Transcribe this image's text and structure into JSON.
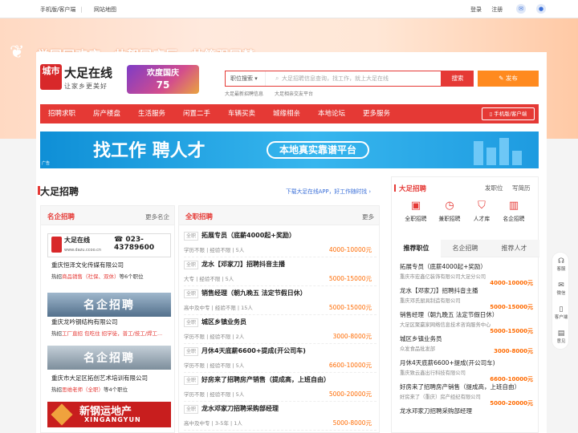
{
  "topbar": {
    "left": [
      "手机版/客户端",
      "网站地图"
    ],
    "login": "登录",
    "register": "注册"
  },
  "hero": {
    "slogan": "举国同欢庆，共贺国庆辰，共筑强国梦"
  },
  "logo": {
    "seal": "城市",
    "name": "大足在线",
    "tagline": "让家乡更美好"
  },
  "badge": {
    "line1": "欢度国庆",
    "line2": "75"
  },
  "search": {
    "category": "职位搜索",
    "placeholder": "大足招聘信息查询，找工作，就上大足在线",
    "button": "搜索",
    "post": "发布",
    "hints": [
      "大足最新招聘信息",
      "大足相亲交友平台"
    ]
  },
  "nav": {
    "items": [
      "招聘求职",
      "房产楼盘",
      "生活服务",
      "闲置二手",
      "车辆买卖",
      "城缘相亲",
      "本地论坛",
      "更多服务"
    ],
    "app": "手机版/客户端"
  },
  "banner": {
    "text": "找工作 聘人才",
    "slogan": "本地真实靠谱平台",
    "tag": "广告"
  },
  "section": {
    "title": "大足招聘",
    "note": "下载大足在线APP，好工作随时找"
  },
  "left": {
    "title": "名企招聘",
    "more": "更多名企",
    "companies": [
      {
        "logo_name": "大足在线",
        "logo_url": "www.dazu.ccoo.cn",
        "logo_phone": "023-43789600",
        "name": "重庆恒泽文化传媒有限公司",
        "hot_prefix": "热招",
        "hot": "商品销售（社保、双休）",
        "hot_suffix": "等6个职位"
      },
      {
        "logo_name": "名企招聘",
        "name": "重庆龙吟钢结构有限公司",
        "hot_prefix": "热招",
        "hot": "工厂直招 包吃住 招学徒，普工/技工/焊工...",
        "hot_suffix": ""
      },
      {
        "logo_name": "名企招聘",
        "name": "重庆市大足区拓创艺术培训有限公司",
        "hot_prefix": "热招",
        "hot": "思维老师（全职）",
        "hot_suffix": "等4个职位"
      },
      {
        "logo_name": "新钢运地产",
        "logo_en": "XINGANGYUN"
      }
    ]
  },
  "middle": {
    "title": "全职招聘",
    "more": "更多",
    "tag": "全职",
    "jobs": [
      {
        "title": "拓展专员（底薪4000起+奖励）",
        "meta": "学历不限 | 经验不限 | 5人",
        "salary": "4000-10000元"
      },
      {
        "title": "龙水【邓家刀】招聘抖音主播",
        "meta": "大专 | 经验不限 | 5人",
        "salary": "5000-15000元"
      },
      {
        "title": "销售经理（朝九晚五 法定节假日休）",
        "meta": "高中及中专 | 经验不限 | 15人",
        "salary": "5000-15000元"
      },
      {
        "title": "城区乡镇业务员",
        "meta": "学历不限 | 经验不限 | 2人",
        "salary": "3000-8000元"
      },
      {
        "title": "月休4天底薪6600+提成(开公司车)",
        "meta": "学历不限 | 经验不限 | 5人",
        "salary": "6600-10000元"
      },
      {
        "title": "好房来了招聘房产销售（提成高，上班自由）",
        "meta": "学历不限 | 经验不限 | 5人",
        "salary": "5000-20000元"
      },
      {
        "title": "龙水邓家刀招聘采购部经理",
        "meta": "高中及中专 | 3-5年 | 1人",
        "salary": "5000-8000元"
      }
    ]
  },
  "sidebar": {
    "title": "大足招聘",
    "post_job": "发职位",
    "write_resume": "写简历",
    "icons": [
      {
        "icon": "briefcase",
        "label": "全职招聘"
      },
      {
        "icon": "clock",
        "label": "兼职招聘"
      },
      {
        "icon": "cap",
        "label": "人才库"
      },
      {
        "icon": "building",
        "label": "名企招聘"
      }
    ],
    "tabs": [
      "推荐职位",
      "名企招聘",
      "推荐人才"
    ],
    "jobs": [
      {
        "title": "拓展专员（底薪4000起+奖励）",
        "company": "重庆市宏鑫亿装饰有限公司大足分公司",
        "salary": "4000-10000元"
      },
      {
        "title": "龙水【邓家刀】招聘抖音主播",
        "company": "重庆邓氏厨具制造有限公司",
        "salary": "5000-15000元"
      },
      {
        "title": "销售经理（朝九晚五 法定节假日休）",
        "company": "大足区聚赢家网络信息技术咨询服务中心",
        "salary": "5000-15000元"
      },
      {
        "title": "城区乡镇业务员",
        "company": "众发食品批发部",
        "salary": "3000-8000元"
      },
      {
        "title": "月休4天底薪6600+提成(开公司车)",
        "company": "重庆致云鑫出行科技有限公司",
        "salary": "6600-10000元"
      },
      {
        "title": "好房来了招聘房产销售（提成高，上班自由）",
        "company": "好房来了（重庆）房产经纪有限公司",
        "salary": "5000-20000元"
      },
      {
        "title": "龙水邓家刀招聘采购部经理",
        "company": "",
        "salary": ""
      }
    ]
  },
  "float": {
    "items": [
      {
        "icon": "headset",
        "label": "客服"
      },
      {
        "icon": "wechat",
        "label": "微信"
      },
      {
        "icon": "mobile",
        "label": "客户端"
      },
      {
        "icon": "book",
        "label": "意见"
      }
    ]
  },
  "colors": {
    "accent": "#e53935",
    "orange": "#ff8a1f",
    "salary": "#ff6a00",
    "link": "#3a6fd8"
  }
}
